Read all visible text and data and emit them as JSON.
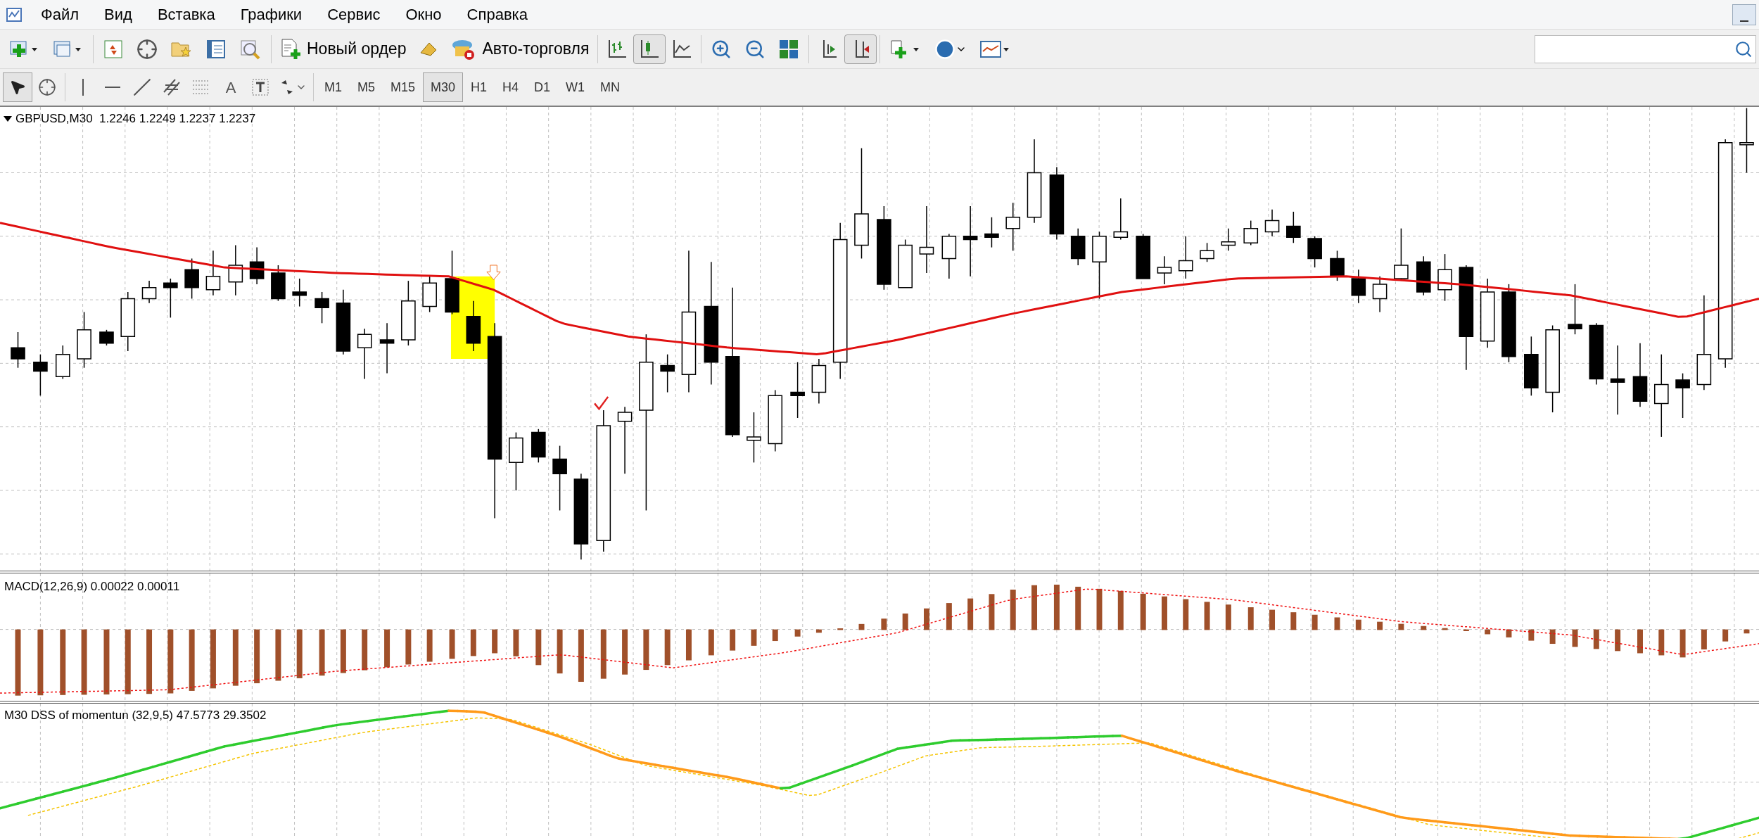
{
  "menu": [
    "Файл",
    "Вид",
    "Вставка",
    "Графики",
    "Сервис",
    "Окно",
    "Справка"
  ],
  "toolbar": {
    "new_order": "Новый ордер",
    "auto_trading": "Авто-торговля"
  },
  "tools": [
    {
      "selected": true
    },
    {
      "selected": false
    },
    {
      "selected": false
    },
    {
      "selected": false
    },
    {
      "selected": false
    },
    {
      "selected": false
    },
    {
      "selected": false
    },
    {
      "selected": false,
      "label": "A"
    },
    {
      "selected": false
    },
    {
      "selected": false
    }
  ],
  "timeframes": [
    {
      "label": "M1",
      "selected": false
    },
    {
      "label": "M5",
      "selected": false
    },
    {
      "label": "M15",
      "selected": false
    },
    {
      "label": "M30",
      "selected": true
    },
    {
      "label": "H1",
      "selected": false
    },
    {
      "label": "H4",
      "selected": false
    },
    {
      "label": "D1",
      "selected": false
    },
    {
      "label": "W1",
      "selected": false
    },
    {
      "label": "MN",
      "selected": false
    }
  ],
  "chart": {
    "title": "GBPUSD,M30  1.2246 1.2249 1.2237 1.2237"
  },
  "macd": {
    "title": "MACD(12,26,9) 0.00022 0.00011"
  },
  "dss": {
    "title": "M30 DSS of momentun (32,9,5) 47.5773 29.3502"
  }
}
